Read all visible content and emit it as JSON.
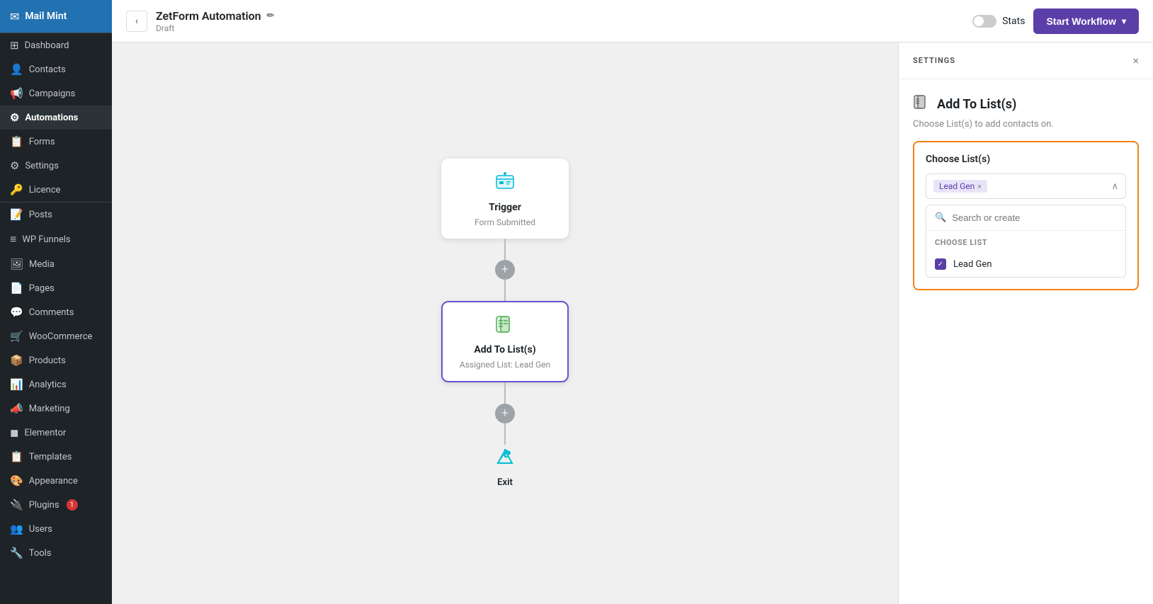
{
  "sidebar": {
    "logo": {
      "icon": "✉",
      "label": "Mail Mint"
    },
    "main_items": [
      {
        "id": "dashboard",
        "label": "Dashboard",
        "icon": "⊞"
      },
      {
        "id": "contacts",
        "label": "Contacts",
        "icon": "👤"
      },
      {
        "id": "campaigns",
        "label": "Campaigns",
        "icon": "📢"
      },
      {
        "id": "automations",
        "label": "Automations",
        "icon": "⚙",
        "active": true,
        "bold": true
      },
      {
        "id": "forms",
        "label": "Forms",
        "icon": "📋"
      },
      {
        "id": "settings",
        "label": "Settings",
        "icon": "⚙"
      },
      {
        "id": "licence",
        "label": "Licence",
        "icon": "🔑"
      }
    ],
    "wp_items": [
      {
        "id": "posts",
        "label": "Posts",
        "icon": "📝"
      },
      {
        "id": "wp-funnels",
        "label": "WP Funnels",
        "icon": "≡"
      },
      {
        "id": "media",
        "label": "Media",
        "icon": "🖼"
      },
      {
        "id": "pages",
        "label": "Pages",
        "icon": "📄"
      },
      {
        "id": "comments",
        "label": "Comments",
        "icon": "💬"
      },
      {
        "id": "woocommerce",
        "label": "WooCommerce",
        "icon": "🛒"
      },
      {
        "id": "products",
        "label": "Products",
        "icon": "📦"
      },
      {
        "id": "analytics",
        "label": "Analytics",
        "icon": "📊"
      },
      {
        "id": "marketing",
        "label": "Marketing",
        "icon": "📣"
      },
      {
        "id": "elementor",
        "label": "Elementor",
        "icon": "◼"
      },
      {
        "id": "templates",
        "label": "Templates",
        "icon": "📋"
      },
      {
        "id": "appearance",
        "label": "Appearance",
        "icon": "🎨"
      },
      {
        "id": "plugins",
        "label": "Plugins",
        "icon": "🔌",
        "badge": "1"
      },
      {
        "id": "users",
        "label": "Users",
        "icon": "👥"
      },
      {
        "id": "tools",
        "label": "Tools",
        "icon": "🔧"
      }
    ]
  },
  "topbar": {
    "back_label": "‹",
    "title": "ZetForm Automation",
    "edit_icon": "✏",
    "subtitle": "Draft",
    "stats_label": "Stats",
    "start_workflow_label": "Start Workflow",
    "chevron": "▾"
  },
  "workflow": {
    "trigger_node": {
      "icon": "🗃",
      "title": "Trigger",
      "subtitle": "Form Submitted"
    },
    "action_node": {
      "icon": "📋",
      "title": "Add To List(s)",
      "subtitle": "Assigned List: Lead Gen",
      "active": true
    },
    "exit_node": {
      "icon": "🚩",
      "label": "Exit"
    },
    "add_btn_label": "+"
  },
  "settings_panel": {
    "title": "SETTINGS",
    "close_icon": "×",
    "section": {
      "icon": "📋",
      "title": "Add To List(s)",
      "description": "Choose List(s) to add contacts on.",
      "choose_list_label": "Choose List(s)",
      "selected_tags": [
        {
          "id": "lead-gen",
          "label": "Lead Gen"
        }
      ],
      "search_placeholder": "Search or create",
      "dropdown_section_title": "CHOOSE LIST",
      "list_items": [
        {
          "id": "lead-gen",
          "label": "Lead Gen",
          "checked": true
        }
      ]
    }
  }
}
